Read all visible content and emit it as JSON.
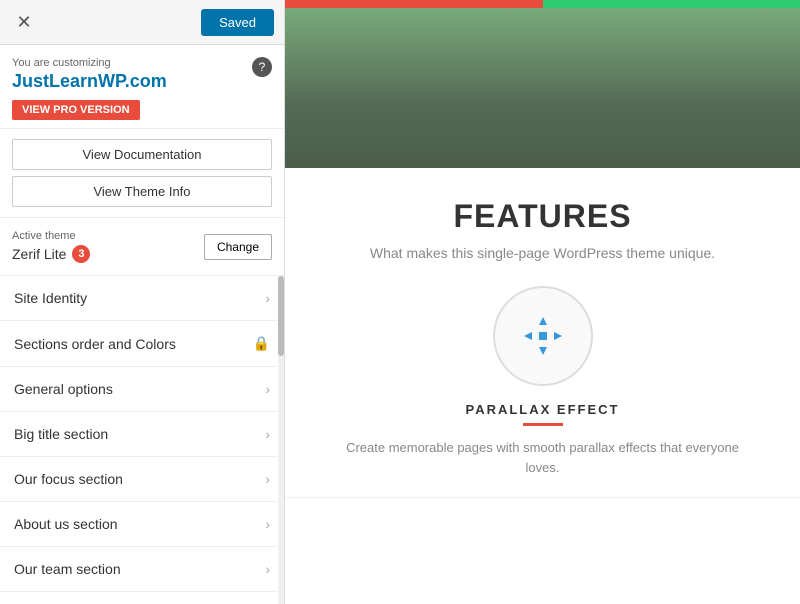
{
  "topbar": {
    "close_label": "✕",
    "saved_label": "Saved"
  },
  "customizing": {
    "subtitle": "You are customizing",
    "site_url": "JustLearnWP.com",
    "view_pro_label": "VIEW PRO VERSION",
    "help_label": "?"
  },
  "doc_buttons": {
    "documentation_label": "View Documentation",
    "theme_info_label": "View Theme Info"
  },
  "active_theme": {
    "label": "Active theme",
    "theme_name": "Zerif Lite",
    "update_count": "3",
    "change_label": "Change"
  },
  "nav_items": [
    {
      "label": "Site Identity",
      "type": "chevron"
    },
    {
      "label": "Sections order and Colors",
      "type": "lock"
    },
    {
      "label": "General options",
      "type": "chevron"
    },
    {
      "label": "Big title section",
      "type": "chevron"
    },
    {
      "label": "Our focus section",
      "type": "chevron"
    },
    {
      "label": "About us section",
      "type": "chevron"
    },
    {
      "label": "Our team section",
      "type": "chevron"
    }
  ],
  "right_panel": {
    "features_title": "FEATURES",
    "features_subtitle": "What makes this single-page WordPress theme unique.",
    "parallax_label": "PARALLAX EFFECT",
    "parallax_desc": "Create memorable pages with smooth parallax effects that everyone loves."
  }
}
